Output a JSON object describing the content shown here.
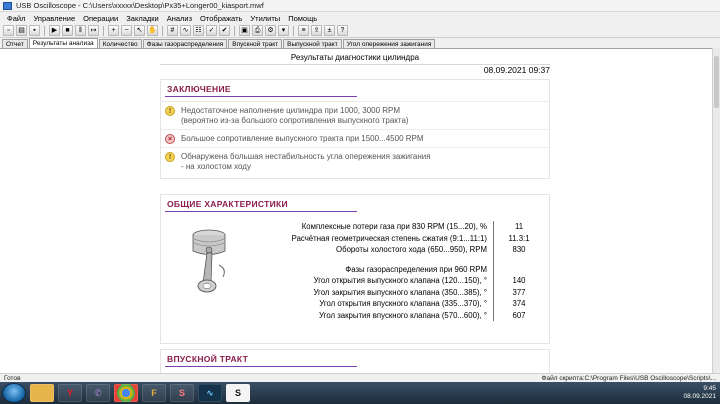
{
  "window": {
    "title": "USB Oscilloscope - C:\\Users\\xxxxx\\Desktop\\Px35+Longer00_kiasport.mwf"
  },
  "menu": [
    "Файл",
    "Управление",
    "Операции",
    "Закладки",
    "Анализ",
    "Отображать",
    "Утилиты",
    "Помощь"
  ],
  "tabs": [
    {
      "label": "Отчет",
      "active": false
    },
    {
      "label": "Результаты анализа",
      "active": true
    },
    {
      "label": "Количество",
      "active": false
    },
    {
      "label": "Фазы газораспределения",
      "active": false
    },
    {
      "label": "Впускной тракт",
      "active": false
    },
    {
      "label": "Выпускной тракт",
      "active": false
    },
    {
      "label": "Угол опережения зажигания",
      "active": false
    }
  ],
  "report": {
    "title": "Результаты диагностики цилиндра",
    "datetime": "08.09.2021 09:37",
    "conclusion": {
      "heading": "ЗАКЛЮЧЕНИЕ",
      "items": [
        {
          "icon": "warning-icon",
          "line1": "Недостаточное наполнение цилиндра при 1000, 3000 RPM",
          "line2": "(вероятно из-за большого сопротивления выпускного тракта)"
        },
        {
          "icon": "error-icon",
          "line1": "Большое сопротивление выпускного тракта при 1500...4500 RPM",
          "line2": ""
        },
        {
          "icon": "warning-icon",
          "line1": "Обнаружена большая нестабильность угла опережения зажигания",
          "line2": "- на холостом ходу"
        }
      ]
    },
    "general": {
      "heading": "ОБЩИЕ ХАРАКТЕРИСТИКИ",
      "rows": [
        {
          "label": "Комплексные потери газа при 830 RPM (15...20), %",
          "value": "11"
        },
        {
          "label": "Расчётная геометрическая степень сжатия (9:1...11:1)",
          "value": "11.3:1"
        },
        {
          "label": "Обороты холостого хода (650...950), RPM",
          "value": "830"
        }
      ],
      "phases_heading": "Фазы газораспределения при 960 RPM",
      "phase_rows": [
        {
          "label": "Угол открытия выпускного клапана (120...150), °",
          "value": "140"
        },
        {
          "label": "Угол закрытия выпускного клапана (350...385), °",
          "value": "377"
        },
        {
          "label": "Угол открытия впускного клапана (335...370), °",
          "value": "374"
        },
        {
          "label": "Угол закрытия впускного клапана (570...600), °",
          "value": "607"
        }
      ]
    },
    "intake": {
      "heading": "ВПУСКНОЙ ТРАКТ"
    }
  },
  "status": {
    "left": "Готов",
    "right": "Файл скрипта:C:\\Program Files\\USB Oscilloscope\\Scripts\\..."
  },
  "taskbar": {
    "icons": [
      "explorer",
      "yandex",
      "viber",
      "chrome",
      "app-f",
      "app-s",
      "oscilloscope",
      "app-doc"
    ],
    "clock_time": "9:45",
    "clock_date": "08.09.2021"
  },
  "colors": {
    "section_heading": "#8b1d4a",
    "underline": "#7a3fb0",
    "warning": "#f3d15a",
    "error": "#c05050"
  }
}
